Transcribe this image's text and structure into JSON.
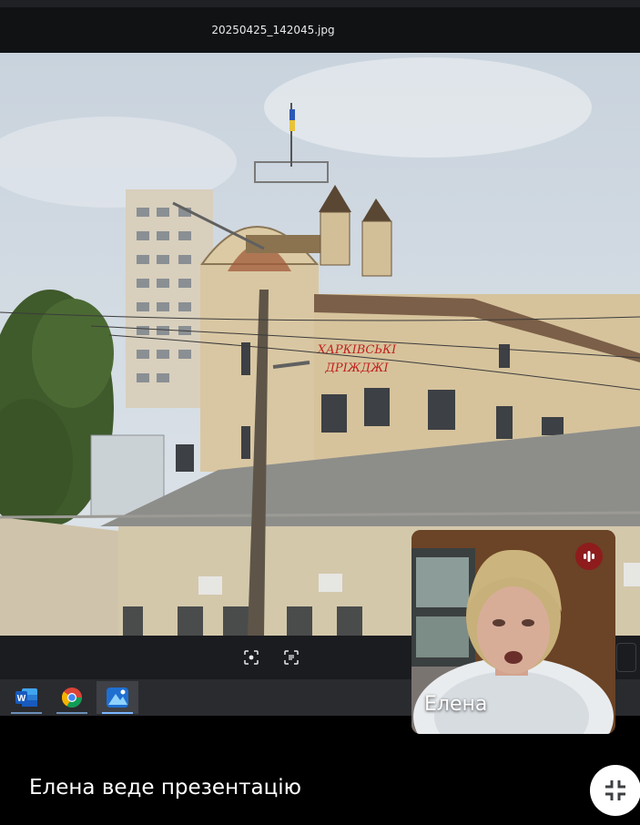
{
  "viewer": {
    "file_name": "20250425_142045.jpg",
    "sign_line1": "ХАРКІВСЬКІ",
    "sign_line2": "ДРІЖДЖІ"
  },
  "viewer_toolbar": {
    "buttons": [
      {
        "icon": "lens-scan-icon"
      },
      {
        "icon": "text-extract-icon"
      }
    ]
  },
  "taskbar": {
    "apps": [
      {
        "icon": "word-icon",
        "active": false
      },
      {
        "icon": "chrome-icon",
        "active": false
      },
      {
        "icon": "photos-icon",
        "active": true
      }
    ]
  },
  "self_view": {
    "name": "Елена",
    "speaking_indicator": "audio-level-icon"
  },
  "presentation": {
    "status": "Елена веде презентацію"
  },
  "colors": {
    "background": "#000000",
    "mic_badge": "#8e1c1c",
    "sign_red": "#c0221e"
  }
}
